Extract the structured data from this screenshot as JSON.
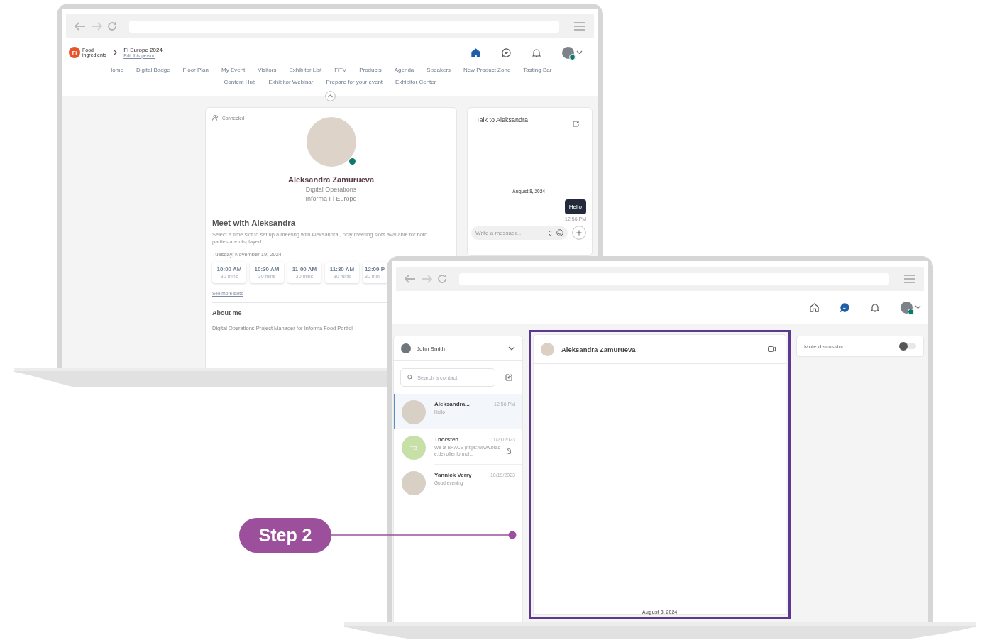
{
  "back_laptop": {
    "brand": {
      "mark": "Fi",
      "line1": "Food",
      "line2": "ingredients"
    },
    "breadcrumb": {
      "title": "Fi Europe 2024",
      "link": "Edit this person"
    },
    "nav_rows": [
      [
        "Home",
        "Digital Badge",
        "Floor Plan",
        "My Event",
        "Visitors",
        "Exhibitor List",
        "FiTV",
        "Products",
        "Agenda",
        "Speakers",
        "New Product Zone",
        "Tasting Bar"
      ],
      [
        "Content Hub",
        "Exhibitor Webinar",
        "Prepare for your event",
        "Exhibitor Center"
      ]
    ],
    "profile": {
      "status": "Connected",
      "online": true,
      "name": "Aleksandra Zamurueva",
      "role": "Digital Operations",
      "company": "Informa Fi Europe",
      "meet_title": "Meet with Aleksandra",
      "meet_text": "Select a time slot to set up a meeting with Aleksandra , only meeting slots available for both parties are displayed.",
      "date": "Tuesday, November 19, 2024",
      "slots": [
        {
          "time": "10:00 AM",
          "duration": "30 mins"
        },
        {
          "time": "10:30 AM",
          "duration": "30 mins"
        },
        {
          "time": "11:00 AM",
          "duration": "30 mins"
        },
        {
          "time": "11:30 AM",
          "duration": "30 mins"
        },
        {
          "time": "12:00 P",
          "duration": "30 min"
        }
      ],
      "more_link": "See more slots",
      "about_title": "About me",
      "about_text": "Digital Operations Project Manager for Informa Food Portfol"
    },
    "chat": {
      "title": "Talk to Aleksandra",
      "date": "August 8, 2024",
      "messages": [
        {
          "text": "Hello",
          "time": "12:56 PM"
        }
      ],
      "placeholder": "Write a message..."
    }
  },
  "front_laptop": {
    "user": {
      "name": "John Smith"
    },
    "search_placeholder": "Search a contact",
    "contacts": [
      {
        "kind": "photo",
        "name": "Aleksandra...",
        "time": "12:56 PM",
        "preview": "Hello",
        "selected": true,
        "muted": false
      },
      {
        "kind": "initials",
        "initials": "TB",
        "name": "Thorsten...",
        "time": "11/21/2023",
        "preview": "We at BRACE (https://www.brace.de) offer formul...",
        "selected": false,
        "muted": true
      },
      {
        "kind": "photo",
        "name": "Yannick Verry",
        "time": "10/19/2023",
        "preview": "Good evening",
        "selected": false,
        "muted": false
      }
    ],
    "conversation": {
      "name": "Aleksandra Zamurueva",
      "date": "August 8, 2024"
    },
    "mute": {
      "label": "Mute discussion",
      "on": false
    }
  },
  "callout": {
    "label": "Step 2"
  }
}
